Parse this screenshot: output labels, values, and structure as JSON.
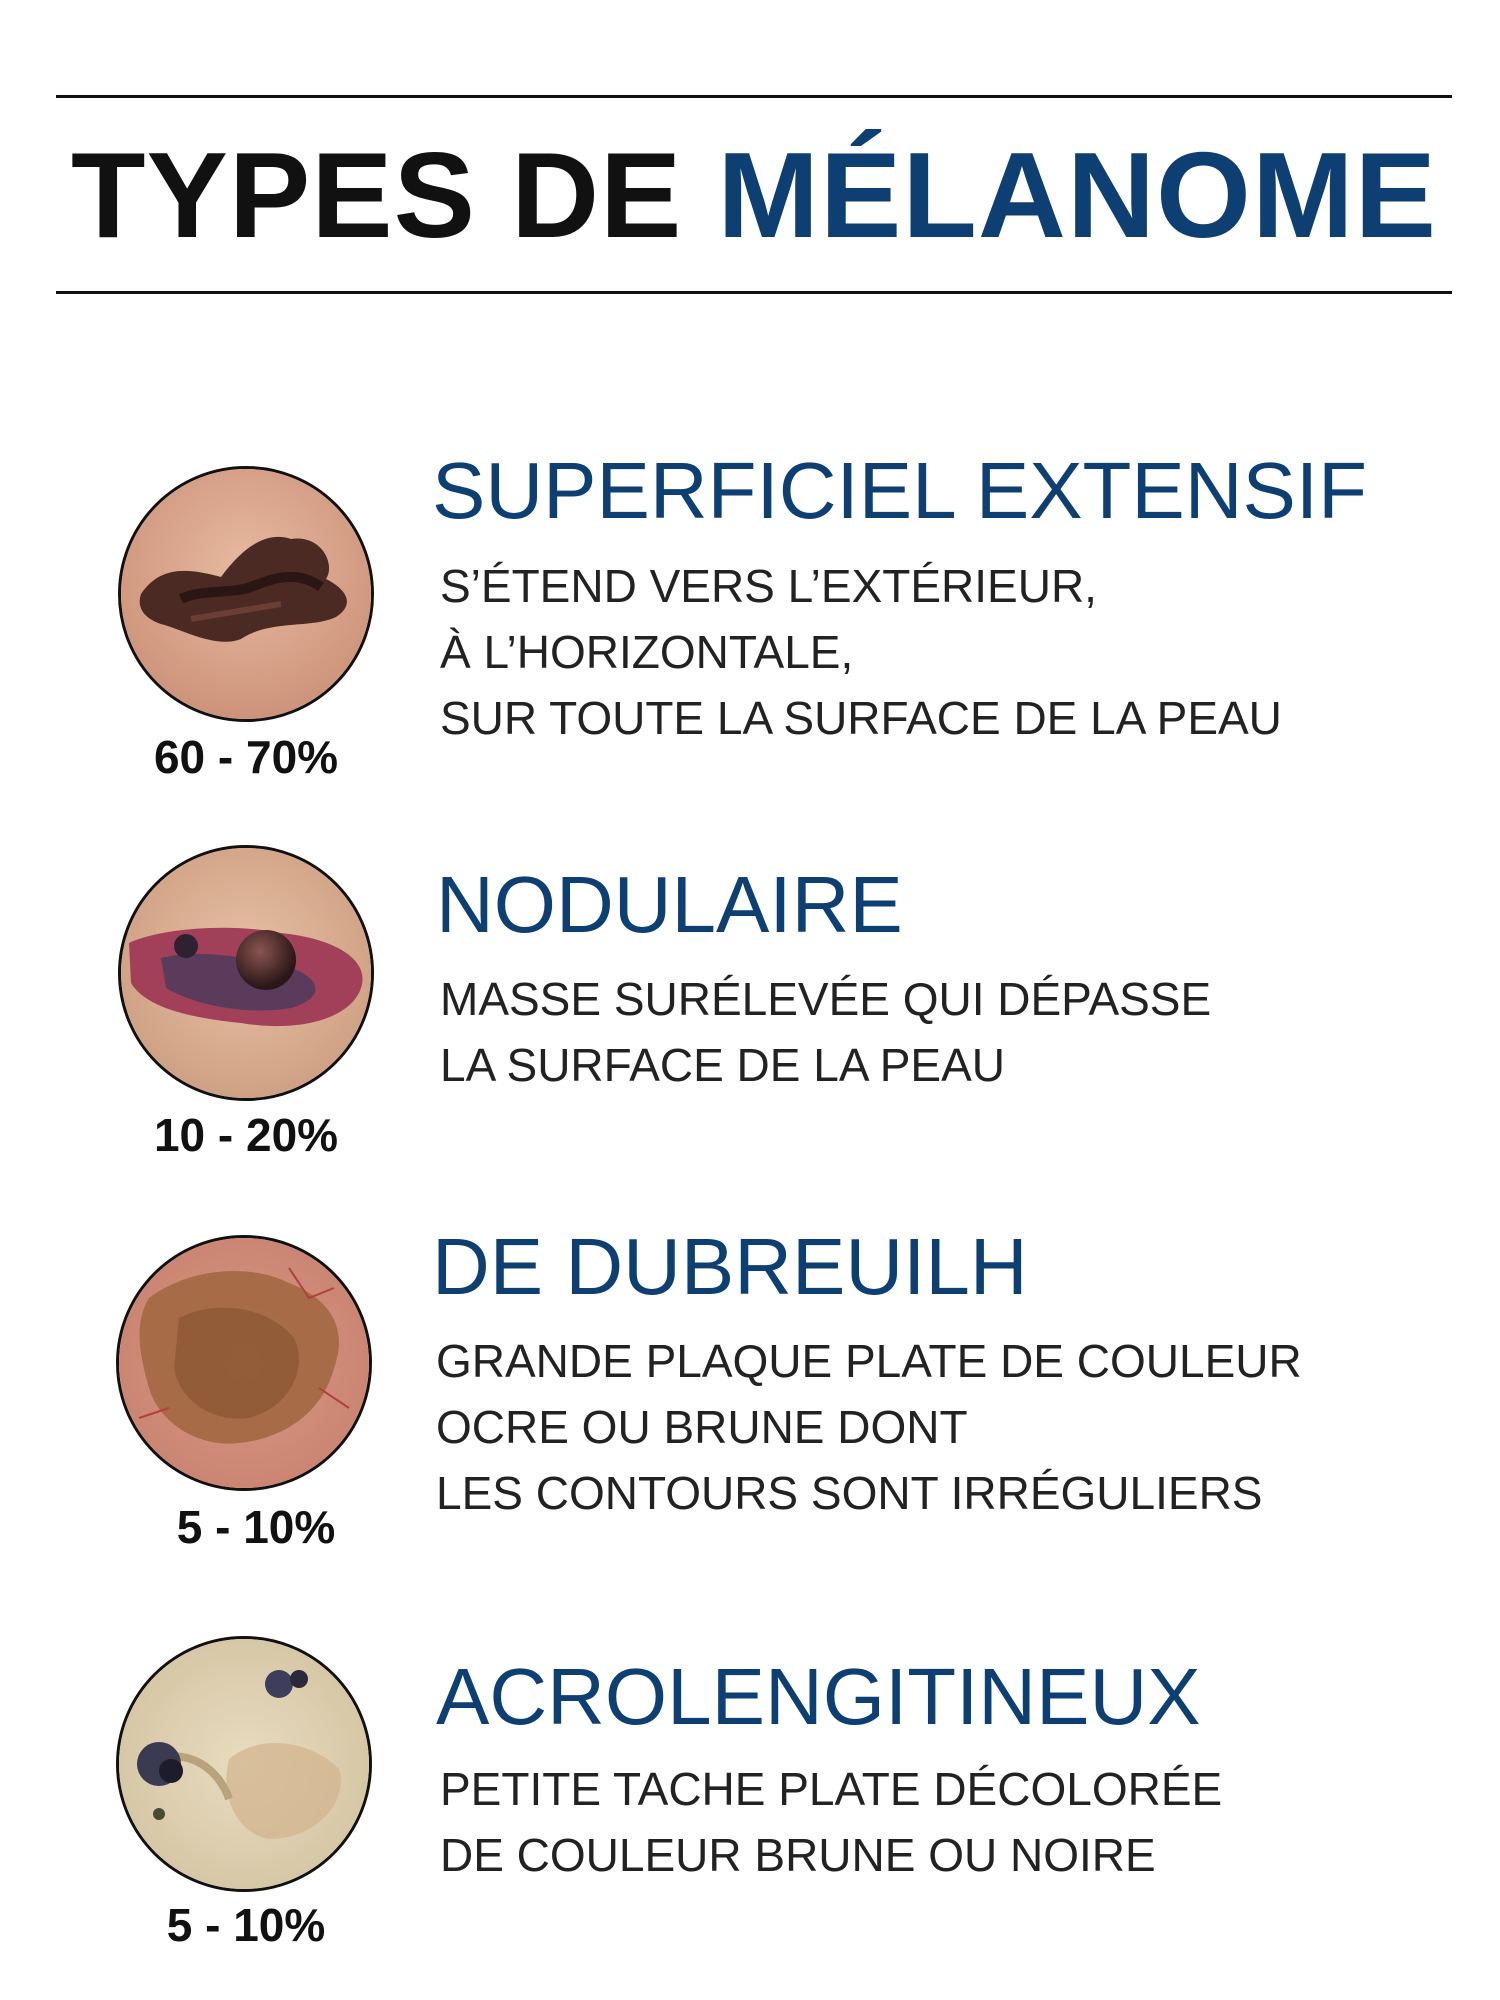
{
  "title": {
    "part1": "TYPES DE",
    "part2": "MÉLANOME"
  },
  "colors": {
    "accent": "#0e3f73",
    "text": "#111111"
  },
  "types": [
    {
      "heading": "SUPERFICIEL EXTENSIF",
      "lines": [
        "S’ÉTEND VERS L’EXTÉRIEUR,",
        "À L’HORIZONTALE,",
        "SUR TOUTE LA SURFACE DE LA PEAU"
      ],
      "percentage": "60 - 70%",
      "image_icon": "superficial-spreading-melanoma-photo"
    },
    {
      "heading": "NODULAIRE",
      "lines": [
        "MASSE SURÉLEVÉE QUI DÉPASSE",
        "LA SURFACE DE LA PEAU"
      ],
      "percentage": "10 - 20%",
      "image_icon": "nodular-melanoma-photo"
    },
    {
      "heading": "DE DUBREUILH",
      "lines": [
        "GRANDE PLAQUE PLATE DE COULEUR",
        "OCRE OU BRUNE DONT",
        "LES CONTOURS SONT IRRÉGULIERS"
      ],
      "percentage": "5 - 10%",
      "image_icon": "lentigo-maligna-photo"
    },
    {
      "heading": "ACROLENGITINEUX",
      "lines": [
        "PETITE TACHE PLATE DÉCOLORÉE",
        "DE COULEUR BRUNE OU NOIRE"
      ],
      "percentage": "5 - 10%",
      "image_icon": "acral-lentiginous-melanoma-photo"
    }
  ]
}
